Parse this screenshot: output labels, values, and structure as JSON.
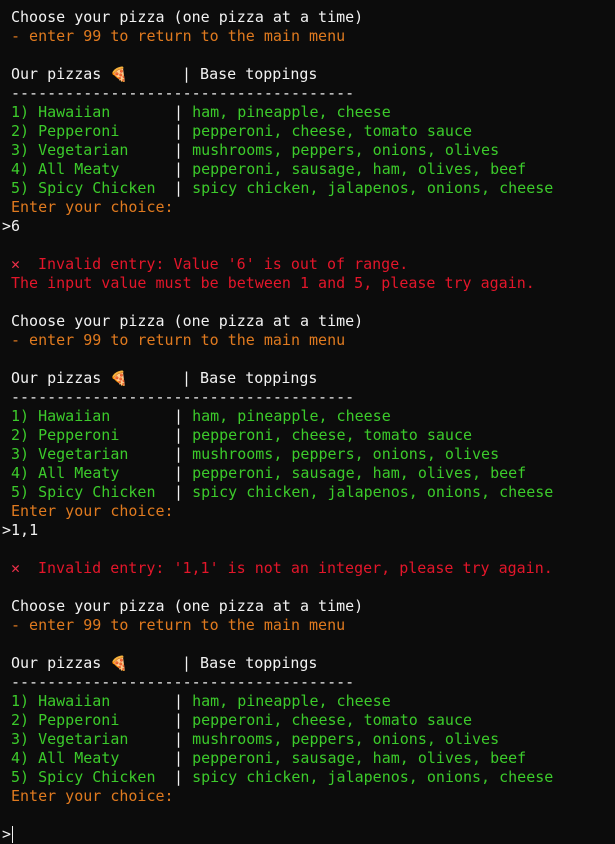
{
  "session": [
    {
      "prompt_title": "Choose your pizza (one pizza at a time)",
      "prompt_hint": "- enter 99 to return to the main menu",
      "menu_header_left": "Our pizzas",
      "menu_header_icon": "pizza-icon",
      "menu_header_right": "| Base toppings",
      "separator": "--------------------------------------",
      "pizzas": [
        {
          "name": "1) Hawaiian",
          "toppings": "ham, pineapple, cheese"
        },
        {
          "name": "2) Pepperoni",
          "toppings": "pepperoni, cheese, tomato sauce"
        },
        {
          "name": "3) Vegetarian",
          "toppings": "mushrooms, peppers, onions, olives"
        },
        {
          "name": "4) All Meaty",
          "toppings": "pepperoni, sausage, ham, olives, beef"
        },
        {
          "name": "5) Spicy Chicken",
          "toppings": "spicy chicken, jalapenos, onions, cheese"
        }
      ],
      "choice_prompt": "Enter your choice:",
      "user_input": ">6",
      "error_line1": "Invalid entry: Value '6' is out of range.",
      "error_line2": "The input value must be between 1 and 5, please try again."
    },
    {
      "prompt_title": "Choose your pizza (one pizza at a time)",
      "prompt_hint": "- enter 99 to return to the main menu",
      "menu_header_left": "Our pizzas",
      "menu_header_icon": "pizza-icon",
      "menu_header_right": "| Base toppings",
      "separator": "--------------------------------------",
      "pizzas": [
        {
          "name": "1) Hawaiian",
          "toppings": "ham, pineapple, cheese"
        },
        {
          "name": "2) Pepperoni",
          "toppings": "pepperoni, cheese, tomato sauce"
        },
        {
          "name": "3) Vegetarian",
          "toppings": "mushrooms, peppers, onions, olives"
        },
        {
          "name": "4) All Meaty",
          "toppings": "pepperoni, sausage, ham, olives, beef"
        },
        {
          "name": "5) Spicy Chicken",
          "toppings": "spicy chicken, jalapenos, onions, cheese"
        }
      ],
      "choice_prompt": "Enter your choice:",
      "user_input": ">1,1",
      "error_line1": "Invalid entry: '1,1' is not an integer, please try again."
    },
    {
      "prompt_title": "Choose your pizza (one pizza at a time)",
      "prompt_hint": "- enter 99 to return to the main menu",
      "menu_header_left": "Our pizzas",
      "menu_header_icon": "pizza-icon",
      "menu_header_right": "| Base toppings",
      "separator": "--------------------------------------",
      "pizzas": [
        {
          "name": "1) Hawaiian",
          "toppings": "ham, pineapple, cheese"
        },
        {
          "name": "2) Pepperoni",
          "toppings": "pepperoni, cheese, tomato sauce"
        },
        {
          "name": "3) Vegetarian",
          "toppings": "mushrooms, peppers, onions, olives"
        },
        {
          "name": "4) All Meaty",
          "toppings": "pepperoni, sausage, ham, olives, beef"
        },
        {
          "name": "5) Spicy Chicken",
          "toppings": "spicy chicken, jalapenos, onions, cheese"
        }
      ],
      "choice_prompt": "Enter your choice:",
      "user_input": ">"
    }
  ],
  "colors": {
    "background": "#0c0c0c",
    "text": "#f2f2f2",
    "hint": "#e07a1f",
    "menu_item": "#3ccb2b",
    "error": "#e3162a"
  }
}
